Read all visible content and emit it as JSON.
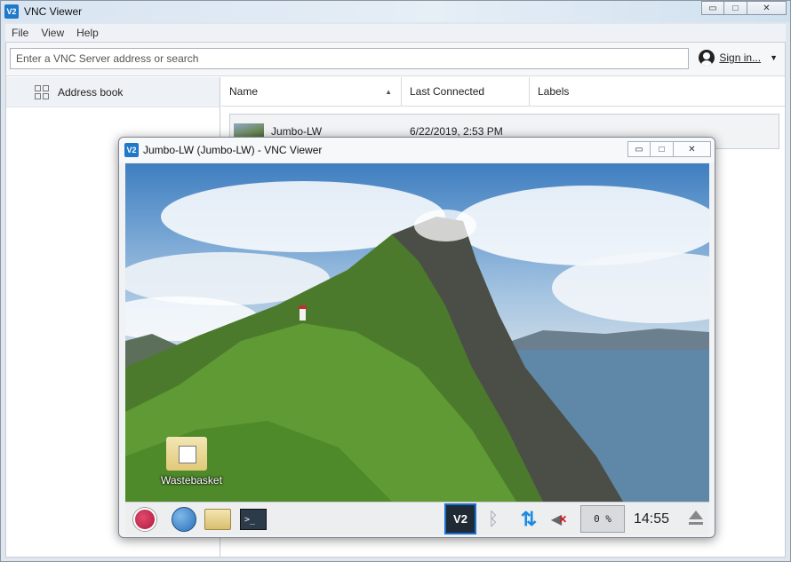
{
  "main_window": {
    "title": "VNC Viewer",
    "logo_text": "V2",
    "controls": {
      "minimize": "▭",
      "maximize": "□",
      "close": "✕"
    }
  },
  "menu": {
    "items": [
      "File",
      "View",
      "Help"
    ]
  },
  "toolbar": {
    "search_placeholder": "Enter a VNC Server address or search",
    "sign_in_label": "Sign in...",
    "sign_in_caret": "▼"
  },
  "sidebar": {
    "items": [
      {
        "label": "Address book",
        "icon": "grid-icon"
      }
    ]
  },
  "list": {
    "columns": [
      {
        "label": "Name",
        "sort": "▲"
      },
      {
        "label": "Last Connected"
      },
      {
        "label": "Labels"
      }
    ],
    "rows": [
      {
        "name": "Jumbo-LW",
        "last_connected": "6/22/2019, 2:53 PM"
      }
    ]
  },
  "remote_window": {
    "title": "Jumbo-LW (Jumbo-LW) - VNC Viewer",
    "logo_text": "V2",
    "controls": {
      "minimize": "▭",
      "maximize": "□",
      "close": "✕"
    },
    "desktop_icon_label": "Wastebasket",
    "taskbar": {
      "terminal_glyph": ">_",
      "vnc_tray_label": "V2",
      "bluetooth_glyph": "ᛒ",
      "network_glyph": "⇅",
      "volume_glyph": "◀",
      "volume_mute_glyph": "✕",
      "cpu_usage": "0 %",
      "clock": "14:55"
    }
  },
  "colors": {
    "accent": "#1f78c8",
    "vnc_tray_border": "#1a6fd0",
    "network": "#1d8be0",
    "mute": "#d01818"
  }
}
